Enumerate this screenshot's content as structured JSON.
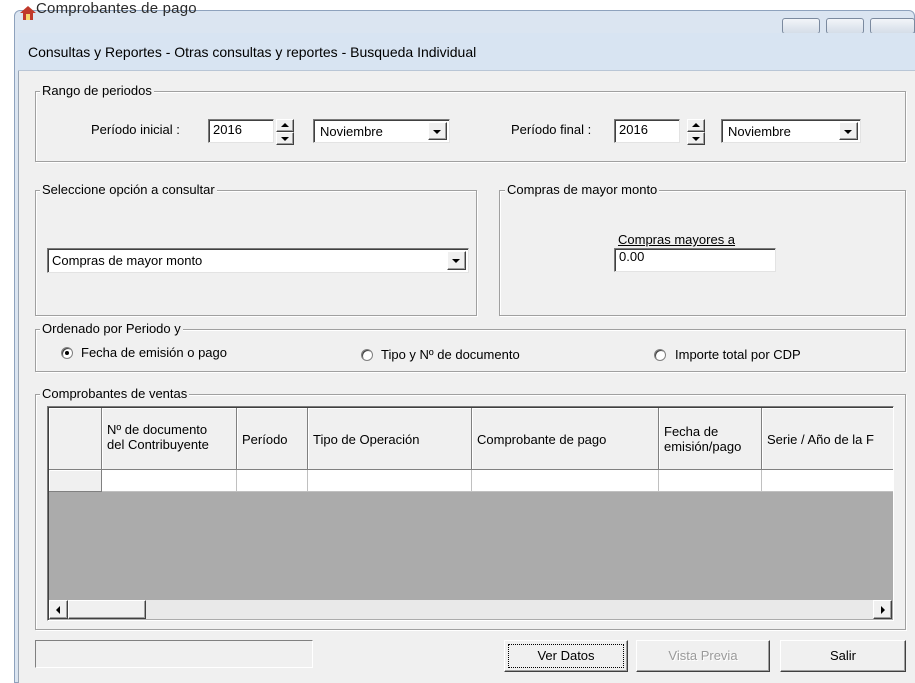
{
  "window": {
    "outer_title": "Comprobantes de pago",
    "dialog_title": "Consultas y Reportes - Otras consultas y reportes - Busqueda Individual"
  },
  "rango": {
    "legend": "Rango de periodos",
    "inicial_label": "Período inicial :",
    "inicial_year": "2016",
    "inicial_month": "Noviembre",
    "final_label": "Período final :",
    "final_year": "2016",
    "final_month": "Noviembre"
  },
  "opcion": {
    "legend": "Seleccione opción a consultar",
    "selected": "Compras de mayor monto"
  },
  "compras": {
    "legend": "Compras de mayor monto",
    "label": "Compras mayores a",
    "value": "0.00"
  },
  "orden": {
    "legend": "Ordenado por Periodo y",
    "options": [
      {
        "label": "Fecha de emisión o pago",
        "checked": true
      },
      {
        "label": "Tipo y Nº de documento",
        "checked": false
      },
      {
        "label": "Importe total por CDP",
        "checked": false
      }
    ]
  },
  "ventas": {
    "legend": "Comprobantes de ventas",
    "columns": [
      "Nº de documento del Contribuyente",
      "Período",
      "Tipo de Operación",
      "Comprobante de pago",
      "Fecha de emisión/pago",
      "Serie / Año de la F"
    ],
    "col_lines": [
      [
        "Nº de documento",
        "del Contribuyente"
      ],
      [
        "Período"
      ],
      [
        "Tipo de Operación"
      ],
      [
        "Comprobante de pago"
      ],
      [
        "Fecha de",
        "emisión/pago"
      ],
      [
        "Serie / Año de la F"
      ]
    ]
  },
  "buttons": {
    "ver_datos": "Ver Datos",
    "vista_previa": "Vista Previa",
    "salir": "Salir"
  },
  "colors": {
    "dialog_bg": "#f0f0f0",
    "titlebar": "#d8e4f2",
    "grid_bg": "#ababab"
  }
}
